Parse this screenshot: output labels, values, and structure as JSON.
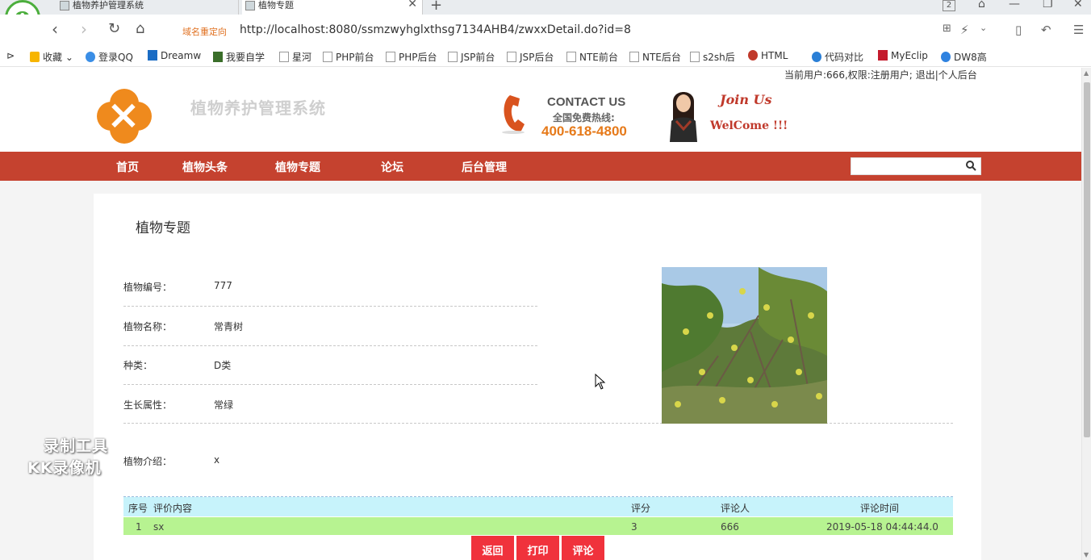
{
  "browser": {
    "tabs": [
      {
        "label": "植物养护管理系统"
      },
      {
        "label": "植物专题"
      }
    ],
    "redirect_label": "域名重定向",
    "url": "http://localhost:8080/ssmzwyhglxthsg7134AHB4/zwxxDetail.do?id=8",
    "tab_count": "2",
    "bookmarks": [
      "收藏",
      "登录QQ",
      "Dreamw",
      "我要自学",
      "星河",
      "PHP前台",
      "PHP后台",
      "JSP前台",
      "JSP后台",
      "NTE前台",
      "NTE后台",
      "s2sh后",
      "HTML",
      "代码对比",
      "MyEclip",
      "DW8高"
    ]
  },
  "header": {
    "user_info": "当前用户:666,权限:注册用户;",
    "logout": "退出",
    "sep": "|",
    "personal": "个人后台",
    "site_title": "植物养护管理系统",
    "contact_us": "CONTACT US",
    "hotline_label": "全国免费热线:",
    "hotline_number": "400-618-4800",
    "join_us": "Join Us",
    "welcome": "WelCome !!!"
  },
  "nav": {
    "items": [
      "首页",
      "植物头条",
      "植物专题",
      "论坛",
      "后台管理"
    ],
    "search_placeholder": ""
  },
  "detail": {
    "section_title": "植物专题",
    "fields": [
      {
        "label": "植物编号：",
        "value": "777"
      },
      {
        "label": "植物名称：",
        "value": "常青树"
      },
      {
        "label": "种类：",
        "value": "D类"
      },
      {
        "label": "生长属性：",
        "value": "常绿"
      }
    ],
    "intro_label": "植物介绍：",
    "intro_value": "x"
  },
  "comments": {
    "headers": {
      "index": "序号",
      "content": "评价内容",
      "score": "评分",
      "user": "评论人",
      "time": "评论时间"
    },
    "rows": [
      {
        "index": "1",
        "content": "sx",
        "score": "3",
        "user": "666",
        "time": "2019-05-18 04:44:44.0"
      }
    ]
  },
  "buttons": {
    "back": "返回",
    "print": "打印",
    "comment": "评论"
  },
  "watermark": {
    "line1": "录制工具",
    "line2": "KK录像机"
  },
  "colors": {
    "nav_bg": "#c5422f",
    "button_bg": "#f0323c",
    "table_head": "#c7f3fb",
    "table_row": "#b7f391"
  }
}
